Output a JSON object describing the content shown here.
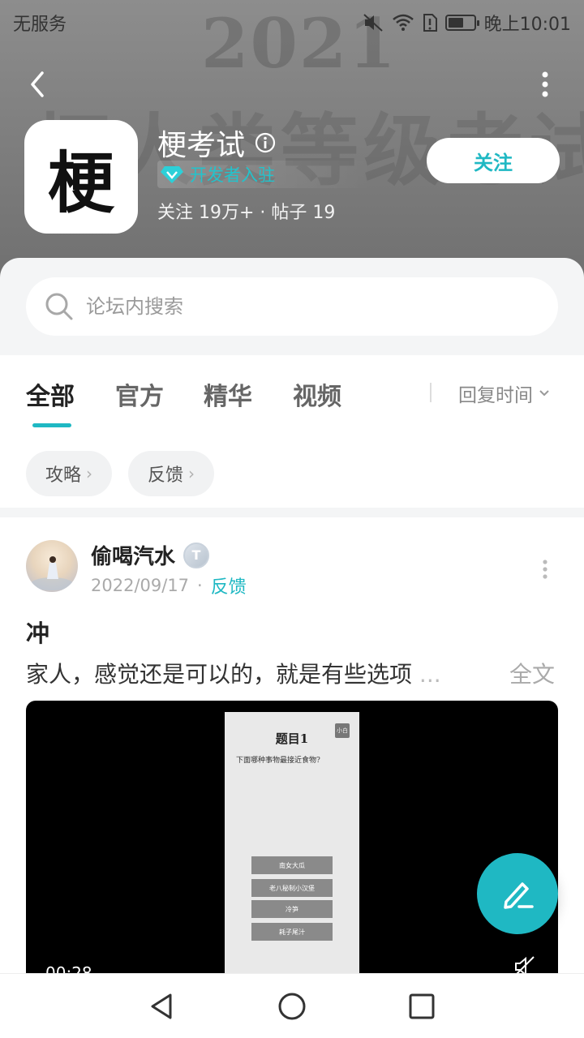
{
  "status_bar": {
    "carrier": "无服务",
    "time": "晚上10:01",
    "battery_level": 0.6
  },
  "header": {
    "background_year": "2021",
    "background_title": "梗人类等级考试",
    "logo_char": "梗",
    "forum_name": "梗考试",
    "dev_badge": "开发者入驻",
    "stats": "关注 19万+ · 帖子 19",
    "follow_label": "关注"
  },
  "search": {
    "placeholder": "论坛内搜索"
  },
  "tabs": [
    {
      "label": "全部",
      "active": true
    },
    {
      "label": "官方",
      "active": false
    },
    {
      "label": "精华",
      "active": false
    },
    {
      "label": "视频",
      "active": false
    }
  ],
  "sort": {
    "label": "回复时间"
  },
  "filters": [
    {
      "label": "攻略"
    },
    {
      "label": "反馈"
    }
  ],
  "post": {
    "author": "偷喝汽水",
    "level_badge": "T",
    "date": "2022/09/17",
    "separator": "·",
    "category": "反馈",
    "title": "冲",
    "body": "家人，感觉还是可以的，就是有些选项",
    "ellipsis": "...",
    "read_more": "全文",
    "video": {
      "duration": "00:28",
      "frame_title": "题目1",
      "frame_question": "下面哪种事物最接近食物?",
      "frame_tag": "小白",
      "options": [
        "南女大瓜",
        "老八秘制小汉堡",
        "冷笋",
        "耗子尾汁"
      ]
    }
  },
  "colors": {
    "accent": "#1fb8c3",
    "header_bg": "#7f7f7f"
  }
}
